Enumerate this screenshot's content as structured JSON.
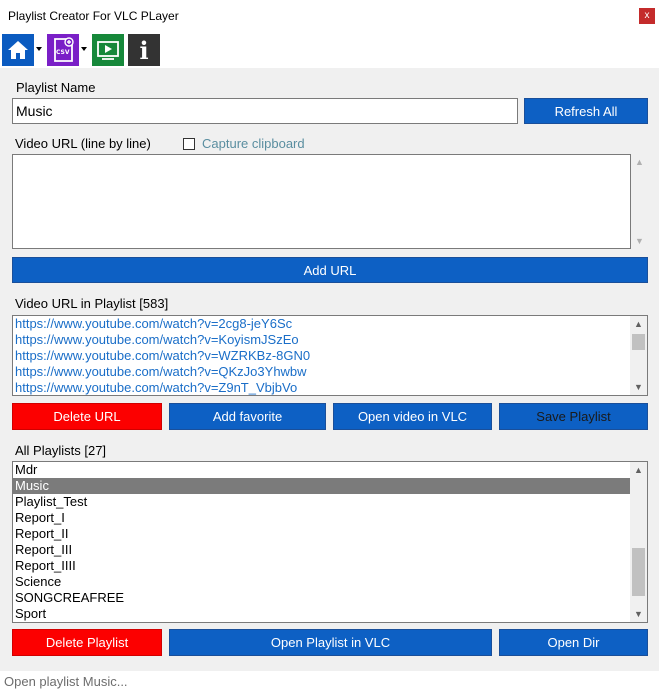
{
  "window": {
    "title": "Playlist Creator For VLC PLayer",
    "close_label": "x"
  },
  "toolbar": {
    "icons": [
      "home-icon",
      "csv-icon",
      "vlc-screen-icon",
      "info-icon"
    ],
    "csv_label": "CSV",
    "info_label": "i"
  },
  "playlist_name": {
    "label": "Playlist Name",
    "value": "Music",
    "refresh_button": "Refresh All"
  },
  "video_url": {
    "label": "Video URL (line by line)",
    "capture_label": "Capture clipboard",
    "capture_checked": false,
    "value": "",
    "add_button": "Add URL"
  },
  "playlist_urls": {
    "label": "Video URL in Playlist [583]",
    "items": [
      "https://www.youtube.com/watch?v=2cg8-jeY6Sc",
      "https://www.youtube.com/watch?v=KoyismJSzEo",
      "https://www.youtube.com/watch?v=WZRKBz-8GN0",
      "https://www.youtube.com/watch?v=QKzJo3Yhwbw",
      "https://www.youtube.com/watch?v=Z9nT_VbjbVo"
    ],
    "buttons": {
      "delete": "Delete URL",
      "favorite": "Add favorite",
      "open_vlc": "Open video in VLC",
      "save": "Save Playlist"
    }
  },
  "all_playlists": {
    "label": "All Playlists [27]",
    "items": [
      "Mdr",
      "Music",
      "Playlist_Test",
      "Report_I",
      "Report_II",
      "Report_III",
      "Report_IIII",
      "Science",
      "SONGCREAFREE",
      "Sport"
    ],
    "selected": "Music",
    "buttons": {
      "delete": "Delete Playlist",
      "open_vlc": "Open Playlist in VLC",
      "open_dir": "Open Dir"
    }
  },
  "status": {
    "text": "Open playlist Music..."
  },
  "colors": {
    "button_blue": "#0d60c4",
    "button_red": "#fc0000",
    "url_link": "#1a6ec8",
    "selection": "#7b7b7b",
    "panel_bg": "#f0f0f0"
  }
}
